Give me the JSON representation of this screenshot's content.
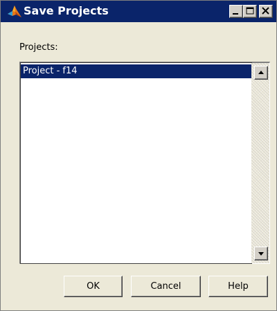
{
  "window": {
    "title": "Save Projects",
    "icon": "matlab-membrane-icon"
  },
  "title_bar_buttons": {
    "minimize_icon": "minimize-icon",
    "maximize_icon": "maximize-icon",
    "close_icon": "close-icon"
  },
  "projects": {
    "label": "Projects:",
    "items": [
      {
        "label": "Project - f14",
        "selected": true
      }
    ]
  },
  "buttons": {
    "ok_label": "OK",
    "cancel_label": "Cancel",
    "help_label": "Help"
  },
  "colors": {
    "title_bar": "#0a246a",
    "selection": "#0a246a",
    "dialog_background": "#ece9d8"
  }
}
